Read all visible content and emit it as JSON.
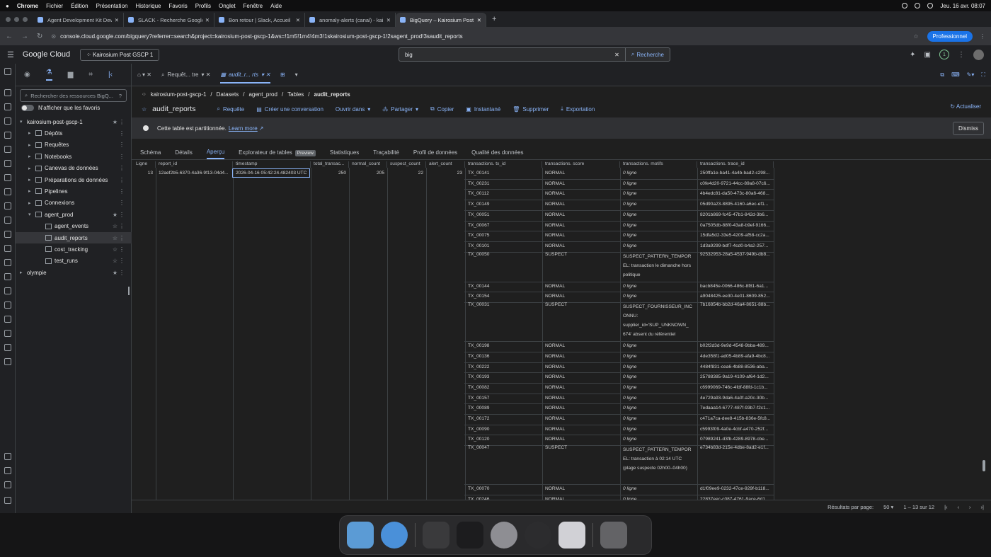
{
  "menubar": {
    "app": "Chrome",
    "items": [
      "Fichier",
      "Édition",
      "Présentation",
      "Historique",
      "Favoris",
      "Profils",
      "Onglet",
      "Fenêtre",
      "Aide"
    ],
    "clock": "Jeu. 16 avr. 08:07"
  },
  "browser_tabs": [
    {
      "title": "Agent Development Kit Dev U",
      "active": false
    },
    {
      "title": "SLACK - Recherche Google",
      "active": false
    },
    {
      "title": "Bon retour | Slack, Accueil",
      "active": false
    },
    {
      "title": "anomaly-alerts (canal) - kair",
      "active": false
    },
    {
      "title": "BigQuery – Kairosium Post G",
      "active": true
    }
  ],
  "address": {
    "url": "console.cloud.google.com/bigquery?referrer=search&project=kairosium-post-gscp-1&ws=!1m5!1m4!4m3!1skairosium-post-gscp-1!2sagent_prod!3saudit_reports",
    "profile": "Professionnel"
  },
  "gcloud": {
    "brand": "Google Cloud",
    "project": "Kairosium Post GSCP 1",
    "search_value": "big",
    "search_button": "Recherche",
    "badge": "1"
  },
  "explorer": {
    "search_placeholder": "Rechercher des ressources BigQ...",
    "favorites_toggle": "N'afficher que les favoris",
    "tree": [
      {
        "label": "kairosium-post-gscp-1",
        "level": 0,
        "expanded": true,
        "star": true
      },
      {
        "label": "Dépôts",
        "level": 1
      },
      {
        "label": "Requêtes",
        "level": 1
      },
      {
        "label": "Notebooks",
        "level": 1
      },
      {
        "label": "Canevas de données",
        "level": 1
      },
      {
        "label": "Préparations de données",
        "level": 1
      },
      {
        "label": "Pipelines",
        "level": 1
      },
      {
        "label": "Connexions",
        "level": 1
      },
      {
        "label": "agent_prod",
        "level": 1,
        "expanded": true,
        "star": true
      },
      {
        "label": "agent_events",
        "level": 2
      },
      {
        "label": "audit_reports",
        "level": 2,
        "selected": true
      },
      {
        "label": "cost_tracking",
        "level": 2
      },
      {
        "label": "test_runs",
        "level": 2
      },
      {
        "label": "olympie",
        "level": 0,
        "star": true
      }
    ]
  },
  "editor_tabs": [
    {
      "label": "Requêt... tre",
      "active": false
    },
    {
      "label": "audit_r... rts",
      "active": true
    }
  ],
  "breadcrumb": [
    "kairosium-post-gscp-1",
    "/",
    "Datasets",
    "/",
    "agent_prod",
    "/",
    "Tables",
    "/",
    "audit_reports"
  ],
  "table_title": "audit_reports",
  "actions": [
    "Requête",
    "Créer une conversation",
    "Ouvrir dans",
    "Partager",
    "Copier",
    "Instantané",
    "Supprimer",
    "Exportation"
  ],
  "refresh": "Actualiser",
  "banner": {
    "text": "Cette table est partitionnée.",
    "link": "Learn more",
    "dismiss": "Dismiss"
  },
  "subtabs": [
    "Schéma",
    "Détails",
    "Aperçu",
    "Explorateur de tables",
    "Statistiques",
    "Traçabilité",
    "Profil de données",
    "Qualité des données"
  ],
  "subtab_active": "Aperçu",
  "preview_badge": "Preview",
  "columns": [
    "Ligne",
    "report_id",
    "timestamp",
    "total_transac...",
    "normal_count",
    "suspect_count",
    "alert_count",
    "transactions. tx_id",
    "transactions. score",
    "transactions. motifs",
    "transactions. trace_id"
  ],
  "main_row": {
    "ligne": "13",
    "report_id": "12aef2b5-6370-4a36-9f13-04d4...",
    "timestamp": "2026-04-16 05:42:24.482403 UTC",
    "total": "250",
    "normal": "205",
    "suspect": "22",
    "alert": "23"
  },
  "transactions": [
    {
      "tx": "TX_00141",
      "score": "NORMAL",
      "motifs": "0 ligne",
      "trace": "250ffa1e-ba41-4a4b-bad2-c298..."
    },
    {
      "tx": "TX_00231",
      "score": "NORMAL",
      "motifs": "0 ligne",
      "trace": "c0fe4d20-9721-44cc-89a8-07c6..."
    },
    {
      "tx": "TX_00112",
      "score": "NORMAL",
      "motifs": "0 ligne",
      "trace": "4b4edc81-da50-473c-80a6-468..."
    },
    {
      "tx": "TX_00149",
      "score": "NORMAL",
      "motifs": "0 ligne",
      "trace": "05d90a23-8895-4160-a6ec-ef1..."
    },
    {
      "tx": "TX_00051",
      "score": "NORMAL",
      "motifs": "0 ligne",
      "trace": "8201b869-fc45-47b1-842d-3b6..."
    },
    {
      "tx": "TX_00067",
      "score": "NORMAL",
      "motifs": "0 ligne",
      "trace": "0a7505db-88f0-43a8-b9ef-9166..."
    },
    {
      "tx": "TX_00075",
      "score": "NORMAL",
      "motifs": "0 ligne",
      "trace": "15dfa5d2-33e5-4209-af58-cc2a..."
    },
    {
      "tx": "TX_00101",
      "score": "NORMAL",
      "motifs": "0 ligne",
      "trace": "1d3a9299-bdf7-4cd0-b4a2-257..."
    },
    {
      "tx": "TX_00050",
      "score": "SUSPECT",
      "motifs": "SUSPECT_PATTERN_TEMPOR EL: transaction le dimanche hors politique",
      "trace": "92532953-28a5-4537-949b-db8...",
      "lines": 3
    },
    {
      "tx": "TX_00144",
      "score": "NORMAL",
      "motifs": "0 ligne",
      "trace": "bacb845e-0066-486c-8f81-6a1..."
    },
    {
      "tx": "TX_00154",
      "score": "NORMAL",
      "motifs": "0 ligne",
      "trace": "a9048425-ee30-4e01-8609-852..."
    },
    {
      "tx": "TX_00031",
      "score": "SUSPECT",
      "motifs": "SUSPECT_FOURNISSEUR_INC ONNU: supplier_id='SUP_UNKNOWN_ 674' absent du référentiel",
      "trace": "7b16854b-bb2d-46a4-8651-88b...",
      "lines": 4
    },
    {
      "tx": "TX_00198",
      "score": "NORMAL",
      "motifs": "0 ligne",
      "trace": "b02f2d3d-9e9d-4548-9bba-489..."
    },
    {
      "tx": "TX_00136",
      "score": "NORMAL",
      "motifs": "0 ligne",
      "trace": "4de358f1-ad05-4b89-afa9-4bc8..."
    },
    {
      "tx": "TX_00222",
      "score": "NORMAL",
      "motifs": "0 ligne",
      "trace": "4484f831-cea6-4b88-8536-aba..."
    },
    {
      "tx": "TX_00193",
      "score": "NORMAL",
      "motifs": "0 ligne",
      "trace": "25788385-9a19-4109-af64-1d2..."
    },
    {
      "tx": "TX_00082",
      "score": "NORMAL",
      "motifs": "0 ligne",
      "trace": "c6999069-746c-4fdf-88fd-1c1b..."
    },
    {
      "tx": "TX_00157",
      "score": "NORMAL",
      "motifs": "0 ligne",
      "trace": "4e729a93-9da6-4a0f-a20c-30b..."
    },
    {
      "tx": "TX_00089",
      "score": "NORMAL",
      "motifs": "0 ligne",
      "trace": "7edaaa14-6777-487f-93b7-f2c1..."
    },
    {
      "tx": "TX_00172",
      "score": "NORMAL",
      "motifs": "0 ligne",
      "trace": "c471a7ca-dee8-415b-836e-5fc8..."
    },
    {
      "tx": "TX_00090",
      "score": "NORMAL",
      "motifs": "0 ligne",
      "trace": "c5993f09-4a0e-4cbf-a470-252f..."
    },
    {
      "tx": "TX_00120",
      "score": "NORMAL",
      "motifs": "0 ligne",
      "trace": "07989241-d3fb-4289-8978-cbe..."
    },
    {
      "tx": "TX_00047",
      "score": "SUSPECT",
      "motifs": "SUSPECT_PATTERN_TEMPOR EL: transaction à 02:14 UTC (plage suspecte 02h00–04h00)",
      "trace": "e734b83d-215e-4dbe-8ad2-e1f...",
      "lines": 4
    },
    {
      "tx": "TX_00070",
      "score": "NORMAL",
      "motifs": "0 ligne",
      "trace": "d1f09ee9-0232-47ce-929f-b118..."
    },
    {
      "tx": "TX_00246",
      "score": "NORMAL",
      "motifs": "0 ligne",
      "trace": "22837eec-c087-4761-9ace-6d1..."
    }
  ],
  "pager": {
    "label": "Résultats par page:",
    "size": "50",
    "range": "1 – 13 sur 12"
  }
}
